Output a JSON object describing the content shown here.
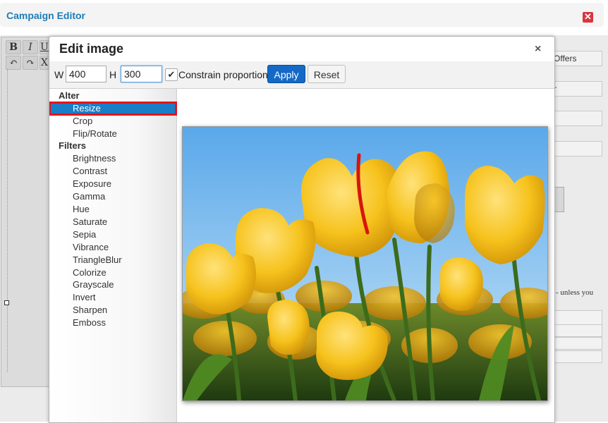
{
  "app": {
    "title": "Campaign Editor",
    "close_glyph": "✕"
  },
  "background": {
    "toolbar_buttons": [
      "B",
      "I",
      "U",
      "↶",
      "↷",
      "X"
    ],
    "right_fields": [
      "Offers",
      "r",
      "",
      "",
      ""
    ],
    "note_fragment": "- unless you"
  },
  "dialog": {
    "title": "Edit image",
    "close_glyph": "×",
    "toolbar": {
      "width_label": "W",
      "width_value": "400",
      "height_label": "H",
      "height_value": "300",
      "constrain_label": "Constrain proportions",
      "constrain_checked": true,
      "apply_label": "Apply",
      "reset_label": "Reset"
    },
    "sidebar": {
      "alter_label": "Alter",
      "alter_items": [
        "Resize",
        "Crop",
        "Flip/Rotate"
      ],
      "selected_item": "Resize",
      "filters_label": "Filters",
      "filter_items": [
        "Brightness",
        "Contrast",
        "Exposure",
        "Gamma",
        "Hue",
        "Saturate",
        "Sepia",
        "Vibrance",
        "TriangleBlur",
        "Colorize",
        "Grayscale",
        "Invert",
        "Sharpen",
        "Emboss"
      ]
    }
  },
  "colors": {
    "accent": "#1f7cb5",
    "selection": "#1a7ec6",
    "highlight_outline": "#e3141b",
    "apply_button": "#1469c6",
    "close_red": "#d9363e"
  },
  "icons": {
    "app_close": "close-icon",
    "dialog_close": "close-icon",
    "checkbox": "checkmark-icon"
  }
}
